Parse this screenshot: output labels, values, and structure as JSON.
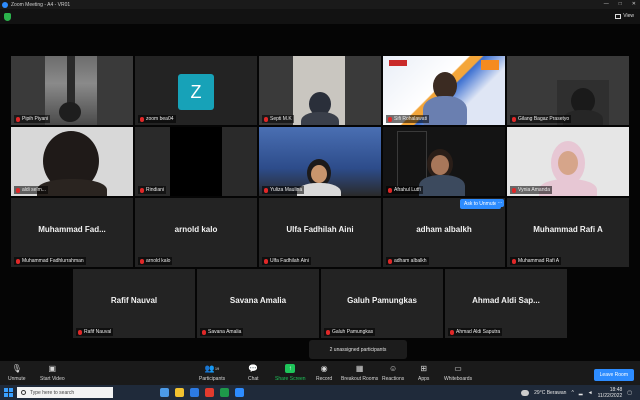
{
  "window": {
    "title": "Zoom Meeting - A4 - VR01",
    "controls": [
      "—",
      "□",
      "✕"
    ]
  },
  "view_label": "View",
  "tiles": [
    {
      "name": "Pipih Piyani"
    },
    {
      "name": "zoom bea04",
      "avatar_letter": "Z"
    },
    {
      "name": "Septi M.K"
    },
    {
      "name": "Sifi Rohalawati"
    },
    {
      "name": "Gilang Bagaz Prasetyo"
    },
    {
      "name": "aldi selm..."
    },
    {
      "name": "Rindiani"
    },
    {
      "name": "Yuliza Maulina"
    },
    {
      "name": "Afrahul Lutfi"
    },
    {
      "name": "Vynia Amanda"
    },
    {
      "name": "Muhammad Fadhlurrahman",
      "display": "Muhammad  Fad..."
    },
    {
      "name": "arnold kalo",
      "display": "arnold kalo"
    },
    {
      "name": "Ulfa Fadhilah Aini",
      "display": "Ulfa Fadhilah Aini"
    },
    {
      "name": "adham albalkh",
      "display": "adham albalkh"
    },
    {
      "name": "Muhammad Rafi A",
      "display": "Muhammad Rafi A"
    },
    {
      "name": "Rafif Nauval",
      "display": "Rafif Nauval"
    },
    {
      "name": "Savana Amalia",
      "display": "Savana Amalia"
    },
    {
      "name": "Galuh Pamungkas",
      "display": "Galuh Pamungkas"
    },
    {
      "name": "Ahmad Aldi Saputra",
      "display": "Ahmad  Aldi  Sap..."
    }
  ],
  "ask_to_unmute": "Ask to Unmute",
  "ask_more": "...",
  "unassigned": "2 unassigned participants",
  "toolbar": {
    "unmute": "Unmute",
    "start_video": "Start Video",
    "participants": "Participants",
    "participants_count": "19",
    "chat": "Chat",
    "share_screen": "Share Screen",
    "record": "Record",
    "breakout_rooms": "Breakout Rooms",
    "reactions": "Reactions",
    "apps": "Apps",
    "whiteboards": "Whiteboards",
    "leave": "Leave Room"
  },
  "taskbar": {
    "search_placeholder": "Type here to search",
    "weather": "29°C  Berawan",
    "time": "18:48",
    "date": "11/22/2022"
  },
  "colors": {
    "accent": "#2d8cff",
    "active_speaker": "#b8e03c",
    "share_green": "#1ec55a",
    "muted_red": "#e02828"
  }
}
